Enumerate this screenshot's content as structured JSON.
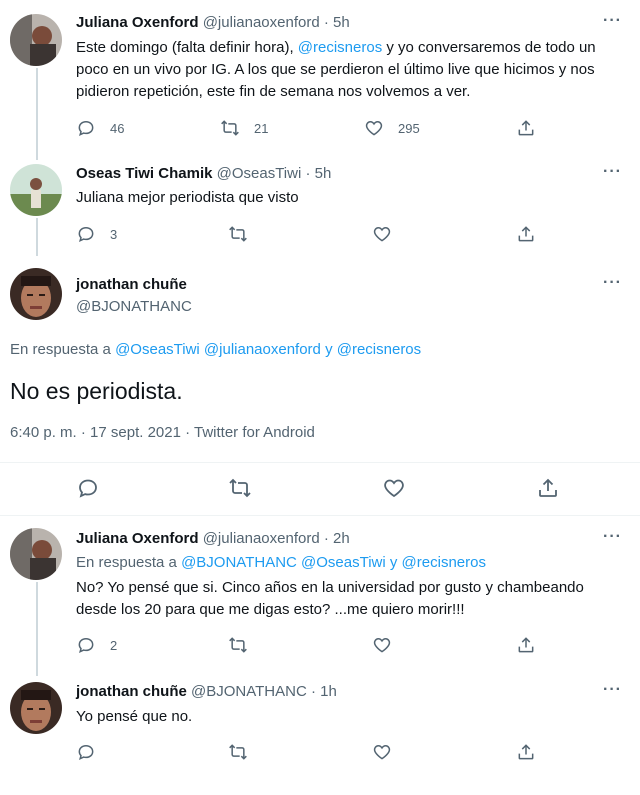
{
  "tweets": [
    {
      "display_name": "Juliana Oxenford",
      "handle": "@julianaoxenford",
      "time": "· 5h",
      "text_parts": [
        "Este domingo (falta definir hora), ",
        "@recisneros",
        " y yo conversaremos de todo un poco en un vivo por IG. A los que se perdieron el último live que hicimos y nos pidieron repetición, este fin de semana nos volvemos a ver."
      ],
      "replies": "46",
      "retweets": "21",
      "likes": "295"
    },
    {
      "display_name": "Oseas Tiwi Chamik",
      "handle": "@OseasTiwi",
      "time": "· 5h",
      "text": "Juliana mejor periodista que visto",
      "replies": "3"
    }
  ],
  "main_tweet": {
    "display_name": "jonathan chuñe",
    "handle": "@BJONATHANC",
    "reply_prefix": "En respuesta a",
    "reply_mentions": "@OseasTiwi @julianaoxenford y @recisneros",
    "text": "No es periodista.",
    "meta": "6:40 p. m. · 17 sept. 2021 · Twitter for Android"
  },
  "replies": [
    {
      "display_name": "Juliana Oxenford",
      "handle": "@julianaoxenford",
      "time": "· 2h",
      "reply_prefix": "En respuesta a",
      "reply_mentions": "@BJONATHANC @OseasTiwi y @recisneros",
      "text": "No? Yo pensé que si. Cinco años en la universidad por gusto y chambeando desde los 20 para que me digas esto? ...me quiero morir!!!",
      "replies": "2"
    },
    {
      "display_name": "jonathan chuñe",
      "handle": "@BJONATHANC",
      "time": "· 1h",
      "text": "Yo pensé que no."
    }
  ],
  "more_glyph": "···",
  "colors": {
    "accent": "#1d9bf0",
    "muted": "#536471",
    "text": "#0f1419",
    "line": "#cfd9de"
  }
}
